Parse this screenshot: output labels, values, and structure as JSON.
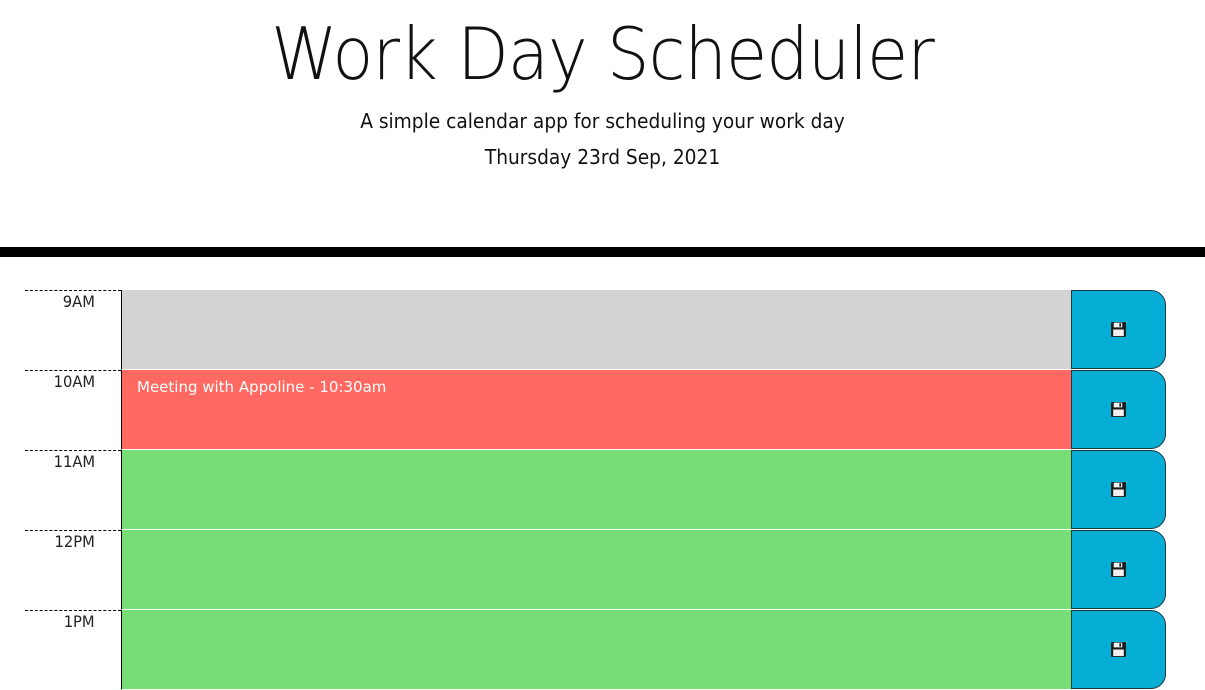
{
  "header": {
    "title": "Work Day Scheduler",
    "lead": "A simple calendar app for scheduling your work day",
    "current_day": "Thursday 23rd Sep, 2021"
  },
  "colors": {
    "past": "#d3d3d3",
    "present": "#ff6961",
    "future": "#77dd77",
    "save_button": "#06aed5"
  },
  "time_blocks": [
    {
      "hour": "9AM",
      "text": "",
      "state": "past",
      "save_icon": "floppy-disk-icon"
    },
    {
      "hour": "10AM",
      "text": "Meeting with Appoline - 10:30am",
      "state": "present",
      "save_icon": "floppy-disk-icon"
    },
    {
      "hour": "11AM",
      "text": "",
      "state": "future",
      "save_icon": "floppy-disk-icon"
    },
    {
      "hour": "12PM",
      "text": "",
      "state": "future",
      "save_icon": "floppy-disk-icon"
    },
    {
      "hour": "1PM",
      "text": "",
      "state": "future",
      "save_icon": "floppy-disk-icon"
    }
  ]
}
